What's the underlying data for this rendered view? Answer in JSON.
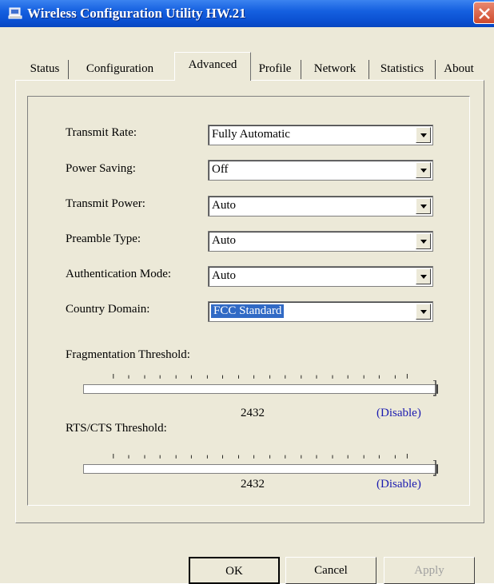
{
  "window": {
    "title": "Wireless Configuration Utility HW.21",
    "accent_color": "#0a4fd0",
    "icons": {
      "app": "network-computer-icon",
      "close": "close-icon"
    }
  },
  "tabs": [
    {
      "label": "Status",
      "active": false
    },
    {
      "label": "Configuration",
      "active": false
    },
    {
      "label": "Advanced",
      "active": true
    },
    {
      "label": "Profile",
      "active": false
    },
    {
      "label": "Network",
      "active": false
    },
    {
      "label": "Statistics",
      "active": false
    },
    {
      "label": "About",
      "active": false
    }
  ],
  "fields": {
    "transmit_rate": {
      "label": "Transmit Rate:",
      "value": "Fully Automatic"
    },
    "power_saving": {
      "label": "Power Saving:",
      "value": "Off"
    },
    "transmit_power": {
      "label": "Transmit Power:",
      "value": "Auto"
    },
    "preamble_type": {
      "label": "Preamble Type:",
      "value": "Auto"
    },
    "authentication_mode": {
      "label": "Authentication Mode:",
      "value": "Auto"
    },
    "country_domain": {
      "label": "Country Domain:",
      "value": "FCC Standard",
      "selected_color": "#316ac5"
    }
  },
  "fragmentation": {
    "label": "Fragmentation Threshold:",
    "value": "2432",
    "state": "(Disable)",
    "level": 1.0
  },
  "rts": {
    "label": "RTS/CTS Threshold:",
    "value": "2432",
    "state": "(Disable)",
    "level": 1.0
  },
  "buttons": {
    "ok": "OK",
    "cancel": "Cancel",
    "apply": "Apply"
  }
}
